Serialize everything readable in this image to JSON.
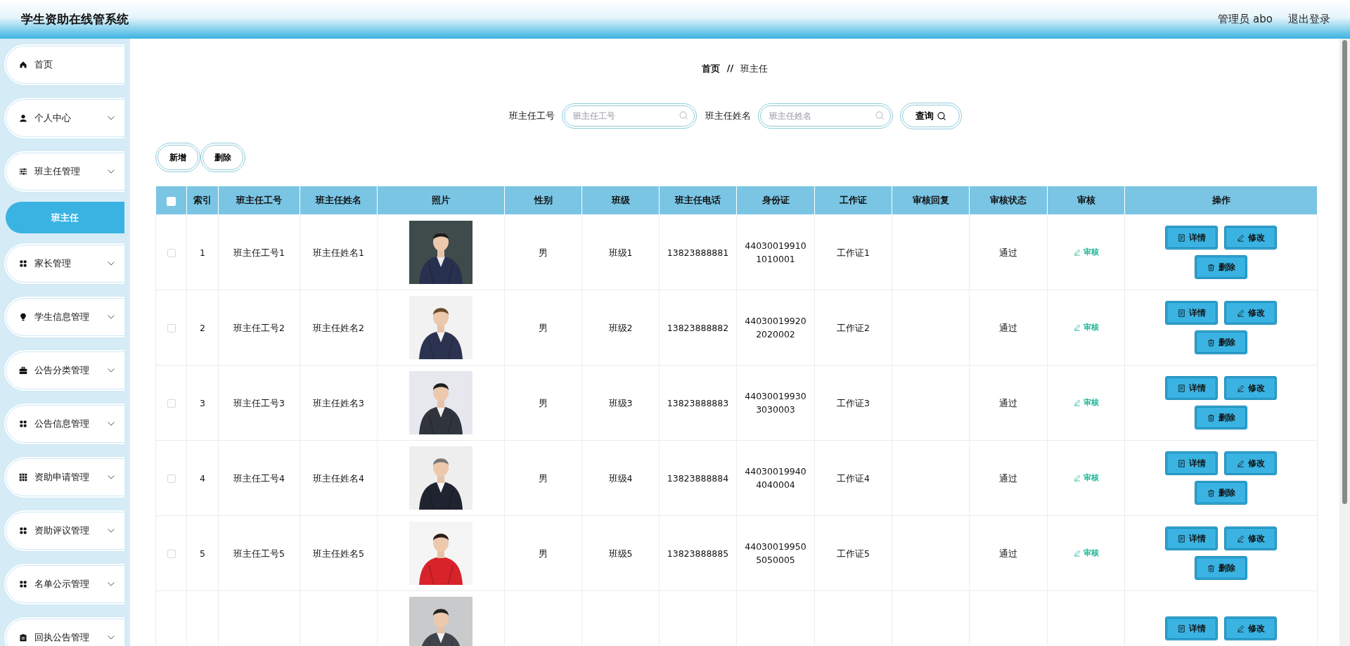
{
  "header": {
    "title": "学生资助在线管系统",
    "user": "管理员 abo",
    "logout": "退出登录"
  },
  "sidebar": {
    "items": [
      {
        "label": "首页",
        "kind": "link",
        "selected": false
      },
      {
        "label": "个人中心",
        "kind": "menu",
        "selected": false
      },
      {
        "label": "班主任管理",
        "kind": "menu",
        "selected": false,
        "children": [
          {
            "label": "班主任",
            "selected": true
          }
        ]
      },
      {
        "label": "家长管理",
        "kind": "menu",
        "selected": false
      },
      {
        "label": "学生信息管理",
        "kind": "menu",
        "selected": false
      },
      {
        "label": "公告分类管理",
        "kind": "menu",
        "selected": false
      },
      {
        "label": "公告信息管理",
        "kind": "menu",
        "selected": false
      },
      {
        "label": "资助申请管理",
        "kind": "menu",
        "selected": false
      },
      {
        "label": "资助评议管理",
        "kind": "menu",
        "selected": false
      },
      {
        "label": "名单公示管理",
        "kind": "menu",
        "selected": false
      },
      {
        "label": "回执公告管理",
        "kind": "menu",
        "selected": false
      }
    ]
  },
  "breadcrumb": {
    "items": [
      "首页",
      "班主任"
    ],
    "separator": "//"
  },
  "search": {
    "fields": [
      {
        "label": "班主任工号",
        "placeholder": "班主任工号"
      },
      {
        "label": "班主任姓名",
        "placeholder": "班主任姓名"
      }
    ],
    "button": "查询"
  },
  "toolbar": {
    "buttons": [
      "新增",
      "删除"
    ]
  },
  "table": {
    "all_checked": false,
    "columns": [
      "索引",
      "班主任工号",
      "班主任姓名",
      "照片",
      "性别",
      "班级",
      "班主任电话",
      "身份证",
      "工作证",
      "审核回复",
      "审核状态",
      "审核",
      "操作"
    ],
    "rows": [
      {
        "checked": false,
        "index": "1",
        "teacher_no": "班主任工号1",
        "teacher_name": "班主任姓名1",
        "gender": "男",
        "class": "班级1",
        "phone": "13823888881",
        "id_card": "440300199101010001",
        "work_card": "工作证1",
        "status": "通过",
        "audit": "审核",
        "actions": [
          "详情",
          "修改",
          "删除"
        ]
      },
      {
        "checked": false,
        "index": "2",
        "teacher_no": "班主任工号2",
        "teacher_name": "班主任姓名2",
        "gender": "男",
        "class": "班级2",
        "phone": "13823888882",
        "id_card": "440300199202020002",
        "work_card": "工作证2",
        "status": "通过",
        "audit": "审核",
        "actions": [
          "详情",
          "修改",
          "删除"
        ]
      },
      {
        "checked": false,
        "index": "3",
        "teacher_no": "班主任工号3",
        "teacher_name": "班主任姓名3",
        "gender": "男",
        "class": "班级3",
        "phone": "13823888883",
        "id_card": "440300199303030003",
        "work_card": "工作证3",
        "status": "通过",
        "audit": "审核",
        "actions": [
          "详情",
          "修改",
          "删除"
        ]
      },
      {
        "checked": false,
        "index": "4",
        "teacher_no": "班主任工号4",
        "teacher_name": "班主任姓名4",
        "gender": "男",
        "class": "班级4",
        "phone": "13823888884",
        "id_card": "440300199404040004",
        "work_card": "工作证4",
        "status": "通过",
        "audit": "审核",
        "actions": [
          "详情",
          "修改",
          "删除"
        ]
      },
      {
        "checked": false,
        "index": "5",
        "teacher_no": "班主任工号5",
        "teacher_name": "班主任姓名5",
        "gender": "男",
        "class": "班级5",
        "phone": "13823888885",
        "id_card": "440300199505050005",
        "work_card": "工作证5",
        "status": "通过",
        "audit": "审核",
        "actions": [
          "详情",
          "修改",
          "删除"
        ]
      },
      {
        "actions": [
          "详情",
          "修改"
        ]
      }
    ]
  }
}
